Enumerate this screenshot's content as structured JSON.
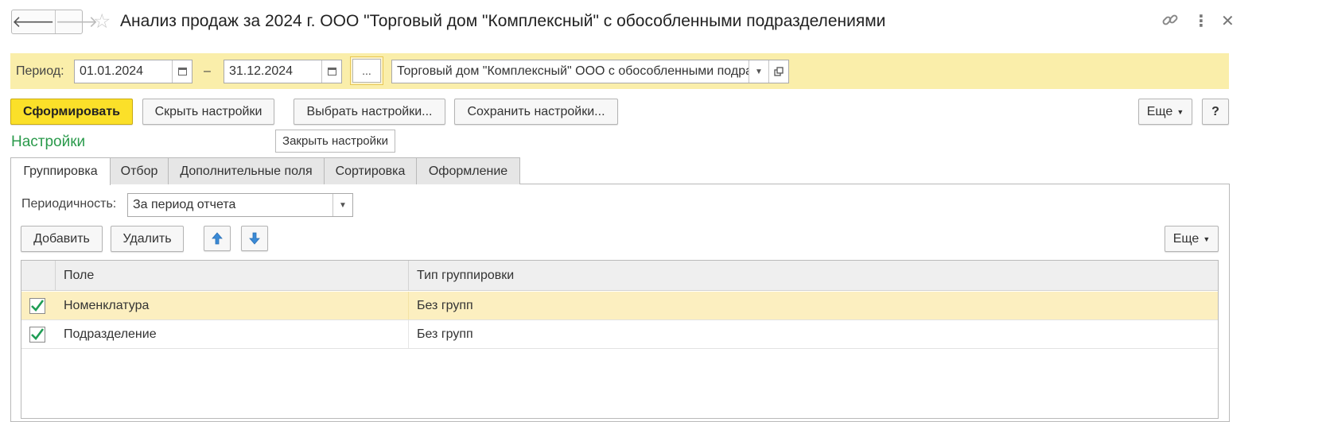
{
  "window": {
    "title": "Анализ продаж за 2024 г. ООО \"Торговый дом \"Комплексный\" с обособленными подразделениями"
  },
  "period": {
    "label": "Период:",
    "start": "01.01.2024",
    "dash": "–",
    "end": "31.12.2024",
    "dots": "...",
    "organization": "Торговый дом \"Комплексный\" ООО с обособленными подразделениями"
  },
  "toolbar": {
    "generate_label": "Сформировать",
    "hide_settings_label": "Скрыть настройки",
    "choose_settings_label": "Выбрать настройки...",
    "save_settings_label": "Сохранить настройки...",
    "more_label": "Еще",
    "help_label": "?"
  },
  "tooltip": {
    "text": "Закрыть настройки"
  },
  "settings": {
    "title": "Настройки",
    "tabs": [
      {
        "label": "Группировка"
      },
      {
        "label": "Отбор"
      },
      {
        "label": "Дополнительные поля"
      },
      {
        "label": "Сортировка"
      },
      {
        "label": "Оформление"
      }
    ],
    "active_tab": "Группировка",
    "periodicity_label": "Периодичность:",
    "periodicity_value": "За период отчета",
    "add_label": "Добавить",
    "delete_label": "Удалить",
    "more_label": "Еще",
    "columns": [
      "Поле",
      "Тип группировки"
    ],
    "rows": [
      {
        "checked": true,
        "field": "Номенклатура",
        "type": "Без групп",
        "selected": true
      },
      {
        "checked": true,
        "field": "Подразделение",
        "type": "Без групп",
        "selected": false
      }
    ]
  },
  "colors": {
    "accent_yellow": "#fbe029",
    "panel_yellow": "#faeeaa",
    "section_green": "#2a9a4b",
    "arrow_blue": "#3a8ad6",
    "check_green": "#1f9d55"
  }
}
